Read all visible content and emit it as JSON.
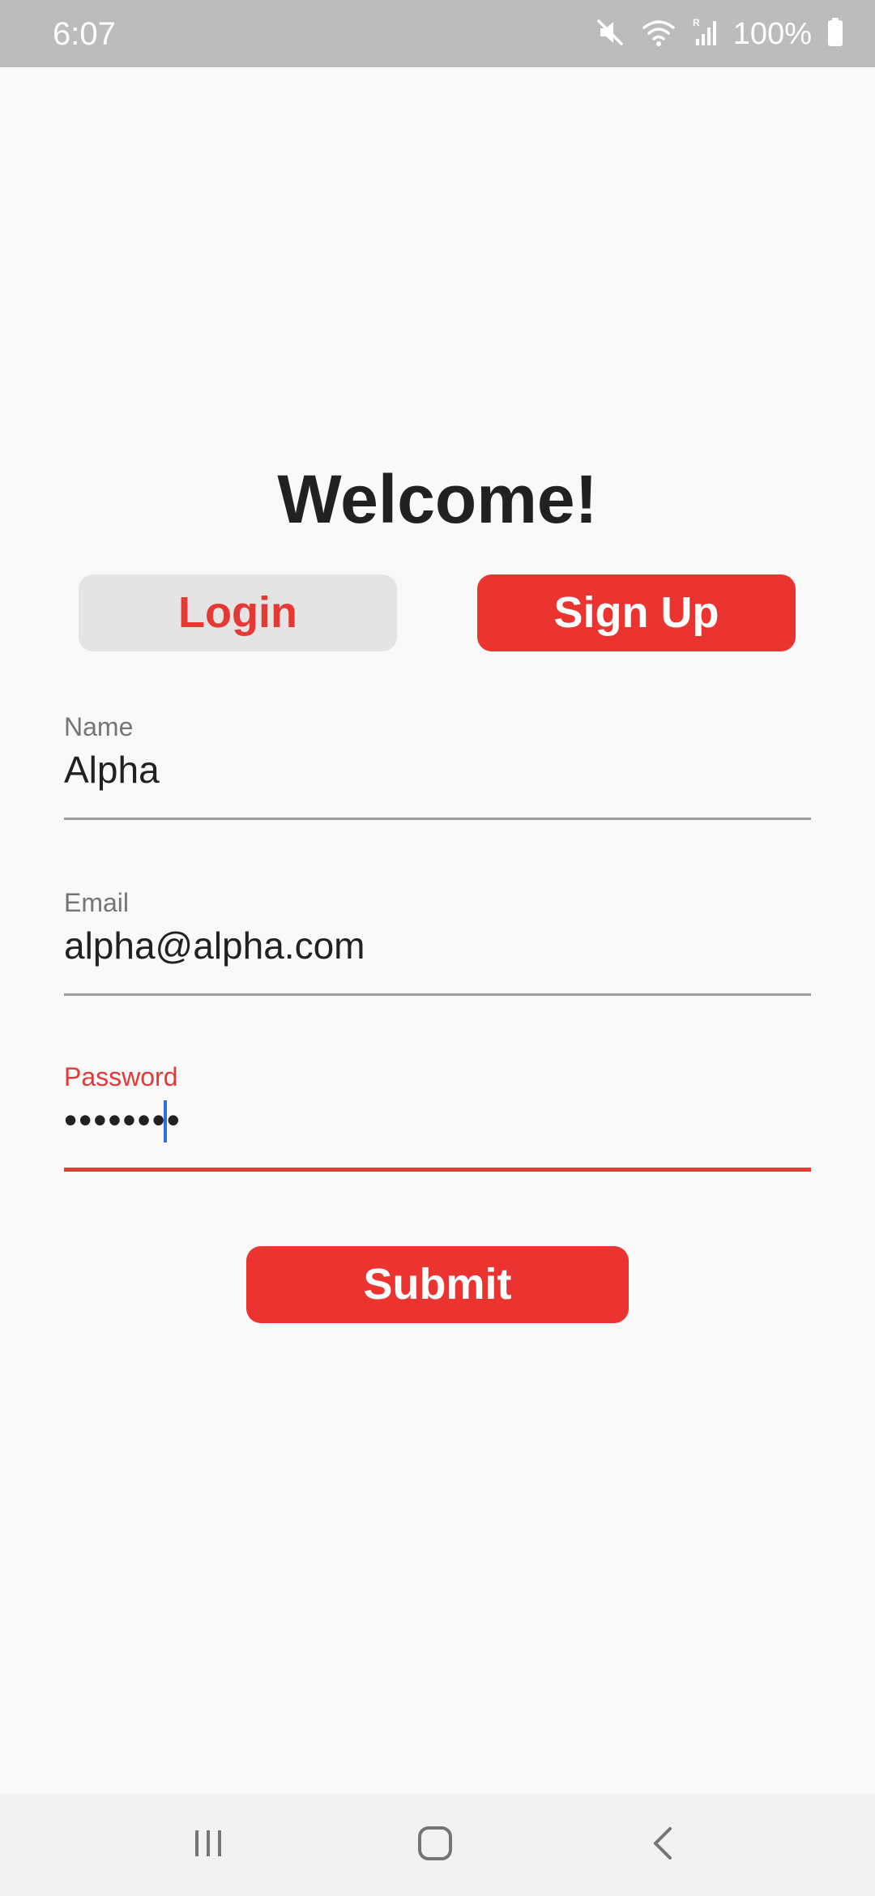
{
  "status_bar": {
    "time": "6:07",
    "battery_text": "100%",
    "icons": [
      "mute-icon",
      "wifi-icon",
      "signal-icon",
      "battery-icon"
    ]
  },
  "main": {
    "title": "Welcome!",
    "tabs": [
      {
        "label": "Login",
        "active": false
      },
      {
        "label": "Sign Up",
        "active": true
      }
    ],
    "fields": {
      "name": {
        "label": "Name",
        "value": "Alpha"
      },
      "email": {
        "label": "Email",
        "value": "alpha@alpha.com"
      },
      "password": {
        "label": "Password",
        "value": "••••••••",
        "focused": true
      }
    },
    "submit_label": "Submit"
  },
  "nav_bar": {
    "icons": [
      "recent-apps-icon",
      "home-icon",
      "back-icon"
    ]
  },
  "colors": {
    "accent": "#eb3430",
    "status_bar": "#bcbcbc",
    "background": "#f9f9f9",
    "cursor": "#2f6fe4"
  }
}
